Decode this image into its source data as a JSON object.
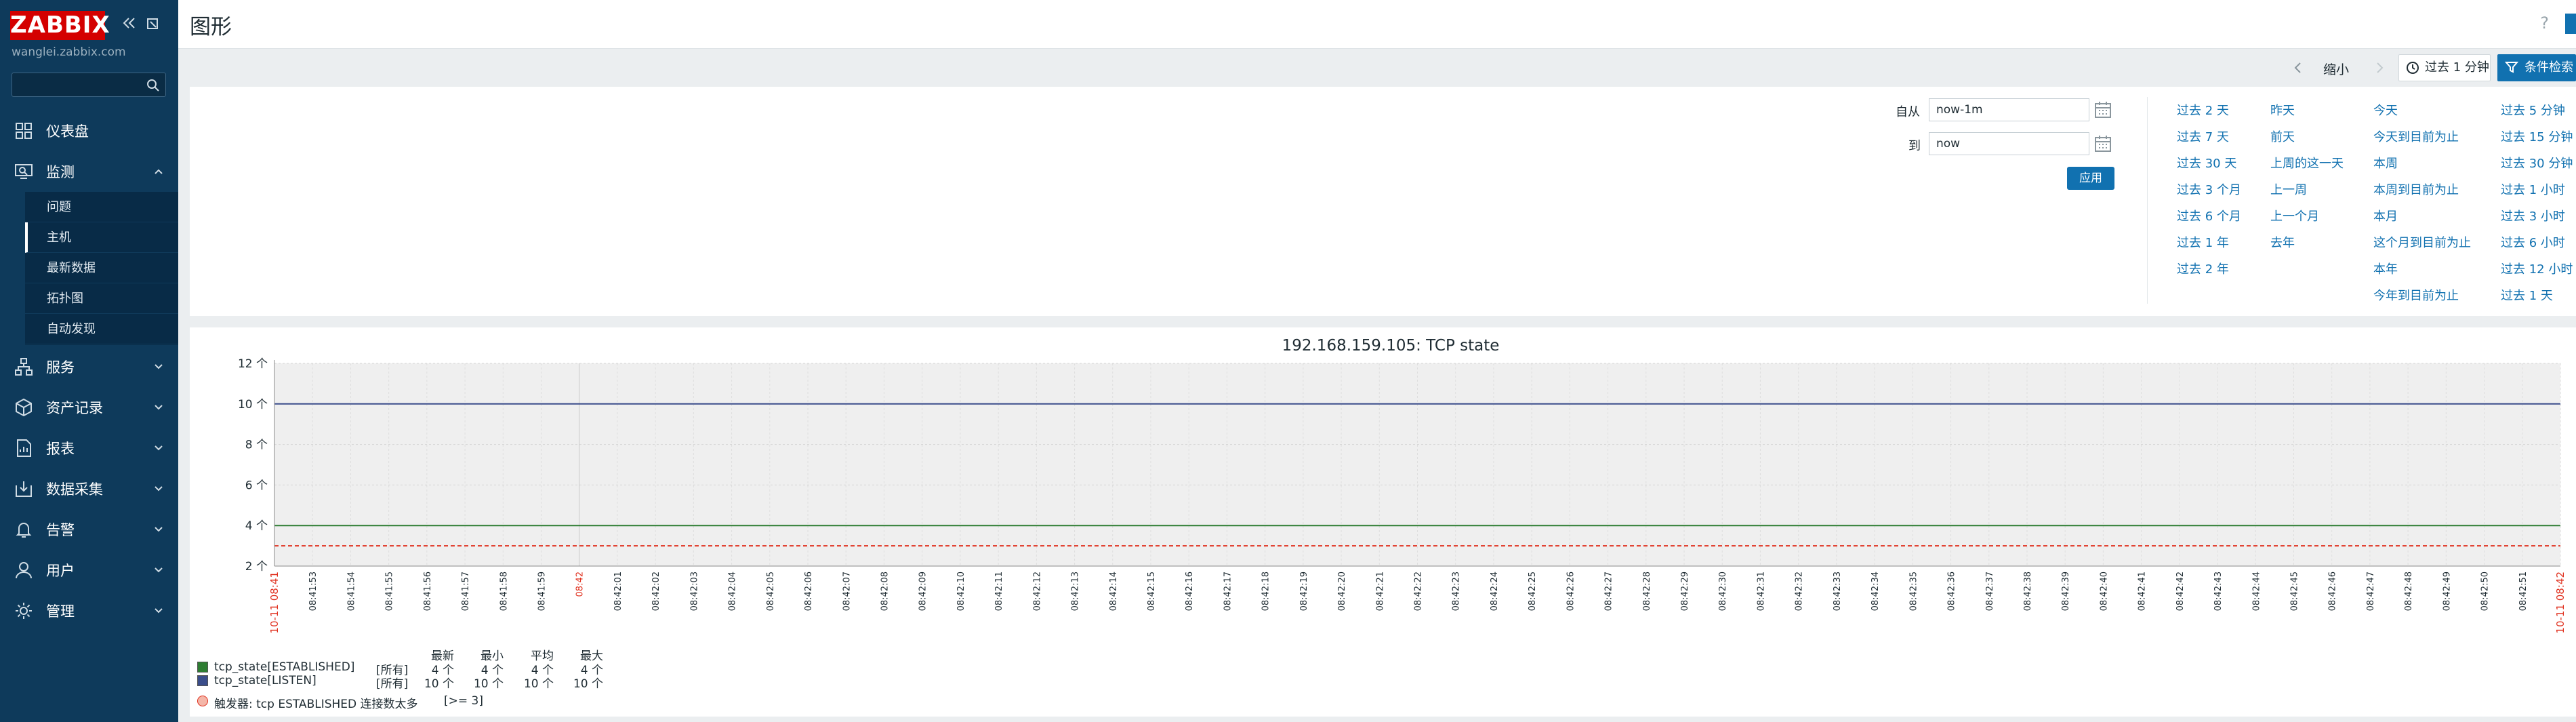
{
  "sidebar": {
    "logo": "ZABBIX",
    "server": "wanglei.zabbix.com",
    "search_placeholder": "",
    "items": [
      {
        "label": "仪表盘",
        "icon": "dashboard-icon"
      },
      {
        "label": "监测",
        "icon": "monitoring-icon",
        "expanded": true
      },
      {
        "label": "服务",
        "icon": "services-icon"
      },
      {
        "label": "资产记录",
        "icon": "inventory-icon"
      },
      {
        "label": "报表",
        "icon": "reports-icon"
      },
      {
        "label": "数据采集",
        "icon": "data-collection-icon"
      },
      {
        "label": "告警",
        "icon": "alerts-icon"
      },
      {
        "label": "用户",
        "icon": "users-icon"
      },
      {
        "label": "管理",
        "icon": "administration-icon"
      }
    ],
    "submenu": [
      "问题",
      "主机",
      "最新数据",
      "拓扑图",
      "自动发现"
    ],
    "active_submenu": "主机"
  },
  "header": {
    "title": "图形",
    "help": "?"
  },
  "timebar": {
    "zoom_out": "缩小",
    "period": "过去 1 分钟",
    "filter": "条件检索"
  },
  "filter": {
    "from_label": "自从",
    "from_value": "now-1m",
    "to_label": "到",
    "to_value": "now",
    "apply": "应用",
    "quick_ranges": [
      [
        "过去 2 天",
        "过去 7 天",
        "过去 30 天",
        "过去 3 个月",
        "过去 6 个月",
        "过去 1 年",
        "过去 2 年"
      ],
      [
        "昨天",
        "前天",
        "上周的这一天",
        "上一周",
        "上一个月",
        "去年"
      ],
      [
        "今天",
        "今天到目前为止",
        "本周",
        "本周到目前为止",
        "本月",
        "这个月到目前为止",
        "本年",
        "今年到目前为止"
      ],
      [
        "过去 5 分钟",
        "过去 15 分钟",
        "过去 30 分钟",
        "过去 1 小时",
        "过去 3 小时",
        "过去 6 小时",
        "过去 12 小时",
        "过去 1 天"
      ]
    ]
  },
  "graph": {
    "title": "192.168.159.105: TCP state",
    "legend_headers": [
      "最新",
      "最小",
      "平均",
      "最大"
    ],
    "legend_items": [
      {
        "name": "tcp_state[ESTABLISHED]",
        "scope": "[所有]",
        "values": [
          "4 个",
          "4 个",
          "4 个",
          "4 个"
        ],
        "color": "#2e7d32"
      },
      {
        "name": "tcp_state[LISTEN]",
        "scope": "[所有]",
        "values": [
          "10 个",
          "10 个",
          "10 个",
          "10 个"
        ],
        "color": "#3a4d8a"
      }
    ],
    "trigger": {
      "label": "触发器: tcp ESTABLISHED 连接数太多",
      "condition": "[>= 3]",
      "color": "#e0301e"
    }
  },
  "chart_data": {
    "type": "line",
    "title": "192.168.159.105: TCP state",
    "ylim": [
      2,
      12
    ],
    "y_ticks": [
      "2 个",
      "4 个",
      "6 个",
      "8 个",
      "10 个",
      "12 个"
    ],
    "x_start_label": "10-11 08:41",
    "x_end_label": "10-11 08:42",
    "x_major_label": "08:42",
    "x": [
      "08:41:53",
      "08:41:54",
      "08:41:55",
      "08:41:56",
      "08:41:57",
      "08:41:58",
      "08:41:59",
      "08:42",
      "08:42:01",
      "08:42:02",
      "08:42:03",
      "08:42:04",
      "08:42:05",
      "08:42:06",
      "08:42:07",
      "08:42:08",
      "08:42:09",
      "08:42:10",
      "08:42:11",
      "08:42:12",
      "08:42:13",
      "08:42:14",
      "08:42:15",
      "08:42:16",
      "08:42:17",
      "08:42:18",
      "08:42:19",
      "08:42:20",
      "08:42:21",
      "08:42:22",
      "08:42:23",
      "08:42:24",
      "08:42:25",
      "08:42:26",
      "08:42:27",
      "08:42:28",
      "08:42:29",
      "08:42:30",
      "08:42:31",
      "08:42:32",
      "08:42:33",
      "08:42:34",
      "08:42:35",
      "08:42:36",
      "08:42:37",
      "08:42:38",
      "08:42:39",
      "08:42:40",
      "08:42:41",
      "08:42:42",
      "08:42:43",
      "08:42:44",
      "08:42:45",
      "08:42:46",
      "08:42:47",
      "08:42:48",
      "08:42:49",
      "08:42:50",
      "08:42:51"
    ],
    "series": [
      {
        "name": "tcp_state[ESTABLISHED]",
        "value": 4,
        "color": "#2e7d32"
      },
      {
        "name": "tcp_state[LISTEN]",
        "value": 10,
        "color": "#3a4d8a"
      }
    ],
    "trigger_threshold": 3,
    "grid": true
  }
}
